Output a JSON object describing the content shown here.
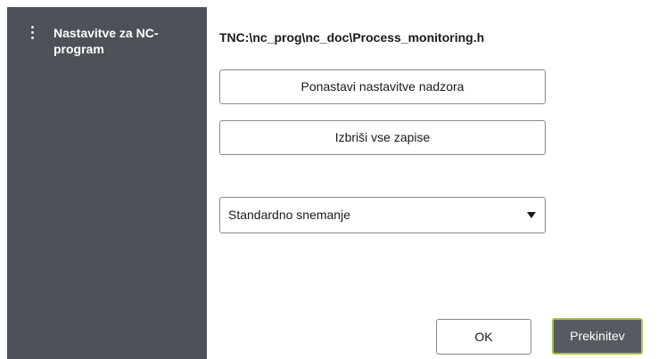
{
  "sidebar": {
    "menu_icon": "more-vertical-icon",
    "title": "Nastavitve za NC-program"
  },
  "main": {
    "path": "TNC:\\nc_prog\\nc_doc\\Process_monitoring.h",
    "reset_button_label": "Ponastavi nastavitve nadzora",
    "delete_button_label": "Izbriši vse zapise",
    "recording_select": {
      "value": "Standardno snemanje",
      "arrow_icon": "caret-down-icon"
    }
  },
  "footer": {
    "ok_label": "OK",
    "cancel_label": "Prekinitev"
  },
  "colors": {
    "sidebar_bg": "#4d5258",
    "cancel_bg": "#555b60",
    "accent_border": "#a9c24a"
  }
}
